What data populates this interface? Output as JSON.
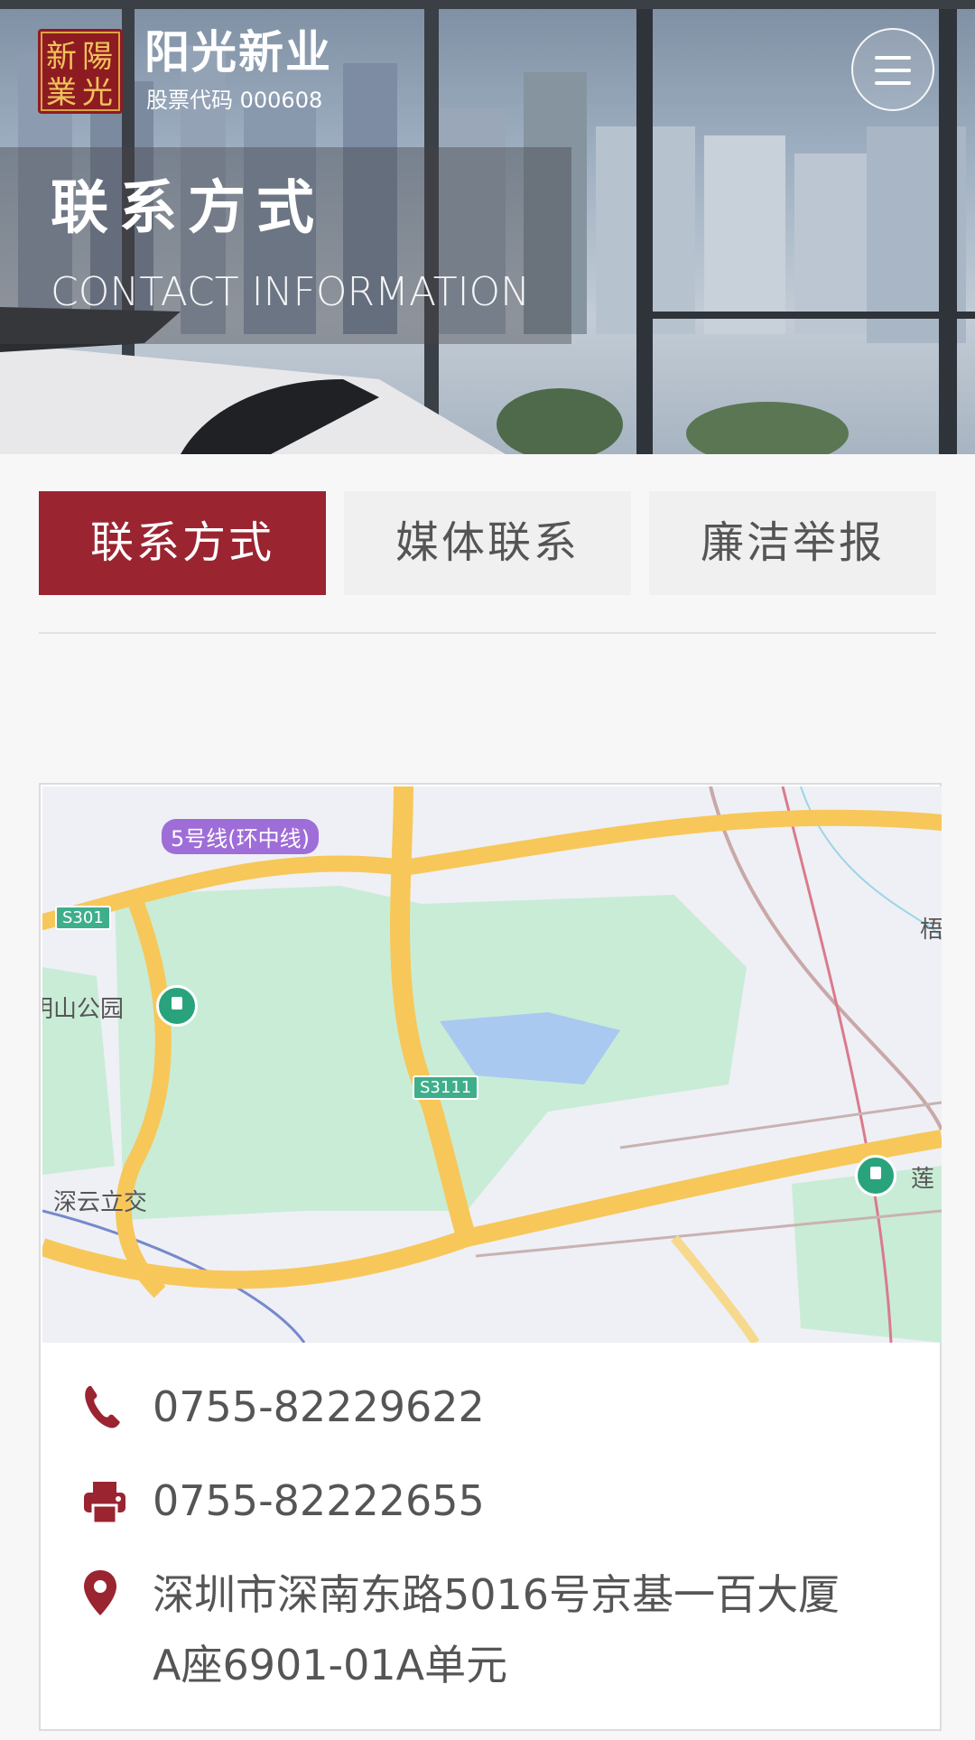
{
  "header": {
    "logo_text": "新陽業光",
    "brand_name": "阳光新业",
    "stock_code": "股票代码  000608",
    "menu_icon": "hamburger-menu-icon"
  },
  "hero": {
    "title": "联系方式",
    "subtitle": "CONTACT INFORMATION"
  },
  "tabs": [
    {
      "label": "联系方式",
      "active": true
    },
    {
      "label": "媒体联系",
      "active": false
    },
    {
      "label": "廉洁举报",
      "active": false
    }
  ],
  "map": {
    "labels": {
      "metro": "5号线(环中线)",
      "road_s301": "S301",
      "road_s3111": "S3111",
      "park": "明山公园",
      "interchange": "深云立交",
      "right_edge_1": "莲",
      "right_edge_2": "梧"
    }
  },
  "contact": {
    "phone": "0755-82229622",
    "fax": "0755-82222655",
    "address_line1": "深圳市深南东路5016号京基一百大厦",
    "address_line2": "A座6901-01A单元"
  },
  "colors": {
    "brand_red": "#9b2431",
    "tab_inactive": "#f0f0f0",
    "map_road": "#f7c75a",
    "map_green": "#c9ecd6"
  }
}
